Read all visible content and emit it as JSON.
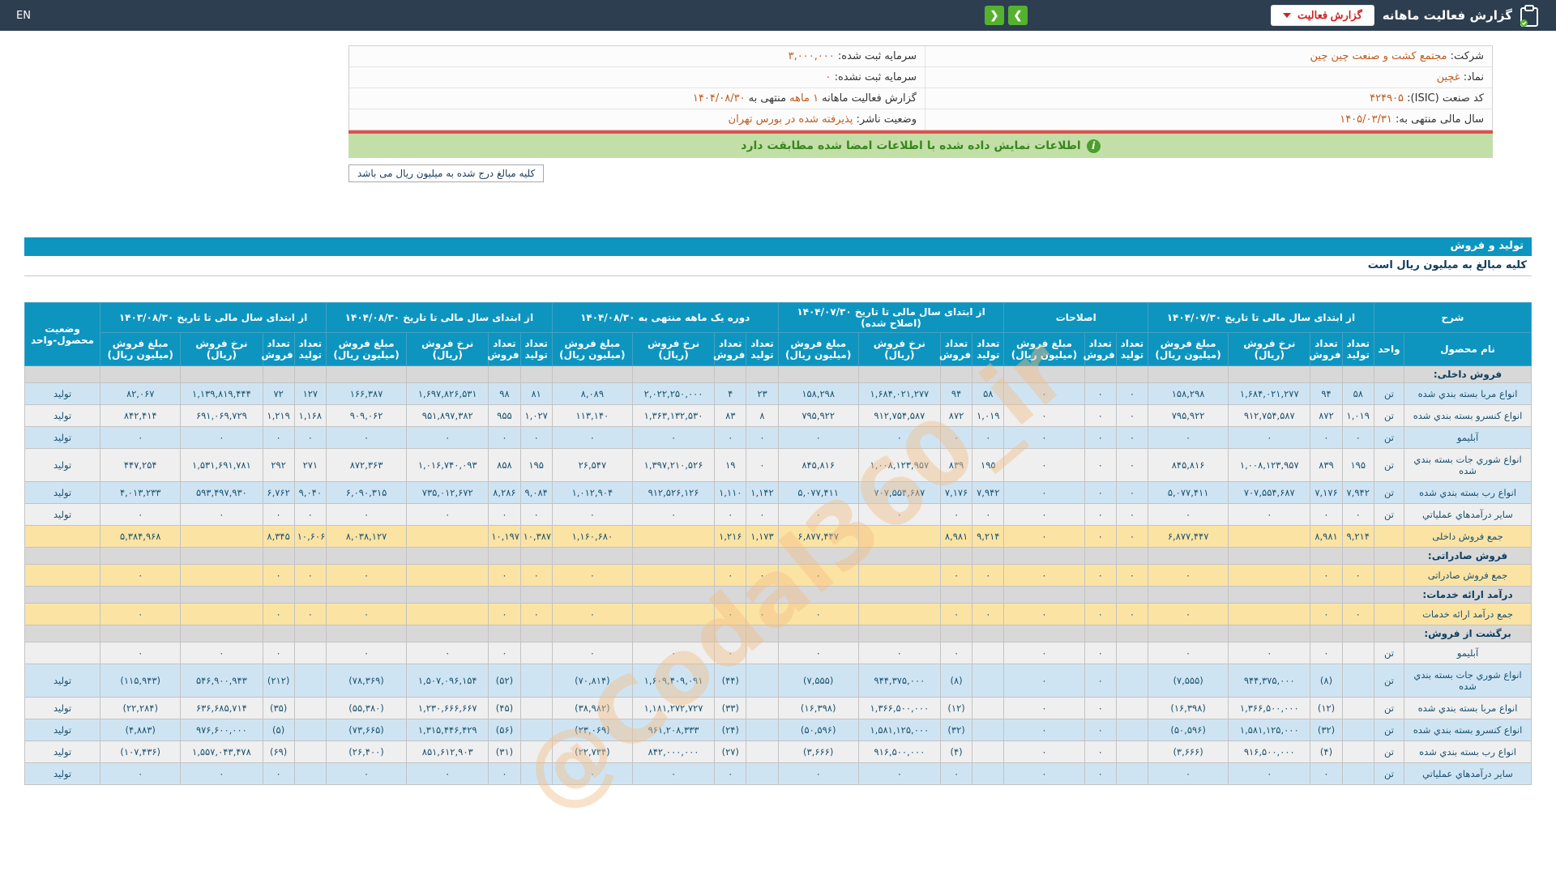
{
  "topbar": {
    "en": "EN",
    "title": "گزارش فعالیت ماهانه",
    "report_button": "گزارش فعالیت",
    "nav_next": "❯",
    "nav_prev": "❮"
  },
  "info": {
    "rows": [
      {
        "right": [
          [
            "l",
            "شرکت:"
          ],
          [
            "v",
            "مجتمع کشت و صنعت چین چین"
          ]
        ],
        "left": [
          [
            "l",
            "سرمایه ثبت شده:"
          ],
          [
            "v",
            "۳,۰۰۰,۰۰۰"
          ]
        ]
      },
      {
        "right": [
          [
            "l",
            "نماد:"
          ],
          [
            "v",
            "غچین"
          ]
        ],
        "left": [
          [
            "l",
            "سرمایه ثبت نشده:"
          ],
          [
            "v",
            "۰"
          ]
        ]
      },
      {
        "right": [
          [
            "l",
            "کد صنعت (ISIC):"
          ],
          [
            "v",
            "۴۲۴۹۰۵"
          ]
        ],
        "left": [
          [
            "l",
            "گزارش فعالیت ماهانه"
          ],
          [
            "v",
            "۱ ماهه"
          ],
          [
            "l",
            "منتهی به"
          ],
          [
            "v",
            "۱۴۰۴/۰۸/۳۰"
          ]
        ]
      },
      {
        "right": [
          [
            "l",
            "سال مالی منتهی به:"
          ],
          [
            "v",
            "۱۴۰۵/۰۳/۳۱"
          ]
        ],
        "left": [
          [
            "l",
            "وضعیت ناشر:"
          ],
          [
            "v",
            "پذیرفته شده در بورس تهران"
          ]
        ]
      }
    ]
  },
  "banner": {
    "text": "اطلاعات نمایش داده شده با اطلاعات امضا شده مطابقت دارد",
    "icon": "i"
  },
  "amounts_note": "کلیه مبالغ درج شده به میلیون ریال می باشد",
  "production_section": {
    "title": "تولید و فروش",
    "note": "کلیه مبالغ به میلیون ریال است"
  },
  "watermark": "@Codal360_ir",
  "table": {
    "groups": [
      {
        "label": "شرح",
        "cols": [
          {
            "label": "نام محصول",
            "key": "name"
          },
          {
            "label": "واحد",
            "key": "unit"
          }
        ]
      },
      {
        "label": "از ابتدای سال مالی تا تاریخ ۱۴۰۴/۰۷/۳۰",
        "cols": [
          {
            "label": "تعداد تولید",
            "key": "a_prod"
          },
          {
            "label": "تعداد فروش",
            "key": "a_sold"
          },
          {
            "label": "نرخ فروش (ریال)",
            "key": "a_rate"
          },
          {
            "label": "مبلغ فروش (میلیون ریال)",
            "key": "a_amt"
          }
        ]
      },
      {
        "label": "اصلاحات",
        "cols": [
          {
            "label": "تعداد تولید",
            "key": "adj_prod"
          },
          {
            "label": "تعداد فروش",
            "key": "adj_sold"
          },
          {
            "label": "مبلغ فروش (میلیون ریال)",
            "key": "adj_amt"
          }
        ]
      },
      {
        "label": "از ابتدای سال مالی تا تاریخ ۱۴۰۴/۰۷/۳۰ (اصلاح شده)",
        "cols": [
          {
            "label": "تعداد تولید",
            "key": "c_prod"
          },
          {
            "label": "تعداد فروش",
            "key": "c_sold"
          },
          {
            "label": "نرخ فروش (ریال)",
            "key": "c_rate"
          },
          {
            "label": "مبلغ فروش (میلیون ریال)",
            "key": "c_amt"
          }
        ]
      },
      {
        "label": "دوره یک ماهه منتهی به ۱۴۰۴/۰۸/۳۰",
        "cols": [
          {
            "label": "تعداد تولید",
            "key": "d_prod"
          },
          {
            "label": "تعداد فروش",
            "key": "d_sold"
          },
          {
            "label": "نرخ فروش (ریال)",
            "key": "d_rate"
          },
          {
            "label": "مبلغ فروش (میلیون ریال)",
            "key": "d_amt"
          }
        ]
      },
      {
        "label": "از ابتدای سال مالی تا تاریخ ۱۴۰۴/۰۸/۳۰",
        "cols": [
          {
            "label": "تعداد تولید",
            "key": "e_prod"
          },
          {
            "label": "تعداد فروش",
            "key": "e_sold"
          },
          {
            "label": "نرخ فروش (ریال)",
            "key": "e_rate"
          },
          {
            "label": "مبلغ فروش (میلیون ریال)",
            "key": "e_amt"
          }
        ]
      },
      {
        "label": "از ابتدای سال مالی تا تاریخ ۱۴۰۳/۰۸/۳۰",
        "cols": [
          {
            "label": "تعداد تولید",
            "key": "f_prod"
          },
          {
            "label": "تعداد فروش",
            "key": "f_sold"
          },
          {
            "label": "نرخ فروش (ریال)",
            "key": "f_rate"
          },
          {
            "label": "مبلغ فروش (میلیون ریال)",
            "key": "f_amt"
          }
        ]
      },
      {
        "label": "وضعیت محصول-واحد",
        "key": "status",
        "rowspan": true
      }
    ],
    "yellow_cols": [
      "a_rate",
      "c_prod",
      "c_sold",
      "c_rate",
      "c_amt",
      "d_rate",
      "e_rate",
      "e_amt",
      "f_rate"
    ],
    "rows": [
      {
        "type": "section",
        "name": "فروش داخلی:"
      },
      {
        "type": "data",
        "stripe": "blue",
        "name": "انواع مربا بسته بندي شده",
        "unit": "تن",
        "status": "تولید",
        "cells": {
          "a_prod": "۵۸",
          "a_sold": "۹۴",
          "a_rate": "۱,۶۸۴,۰۲۱,۲۷۷",
          "a_amt": "۱۵۸,۲۹۸",
          "adj_prod": "۰",
          "adj_sold": "۰",
          "adj_amt": "۰",
          "c_prod": "۵۸",
          "c_sold": "۹۴",
          "c_rate": "۱,۶۸۴,۰۲۱,۲۷۷",
          "c_amt": "۱۵۸,۲۹۸",
          "d_prod": "۲۳",
          "d_sold": "۴",
          "d_rate": "۲,۰۲۲,۲۵۰,۰۰۰",
          "d_amt": "۸,۰۸۹",
          "e_prod": "۸۱",
          "e_sold": "۹۸",
          "e_rate": "۱,۶۹۷,۸۲۶,۵۳۱",
          "e_amt": "۱۶۶,۳۸۷",
          "f_prod": "۱۲۷",
          "f_sold": "۷۲",
          "f_rate": "۱,۱۳۹,۸۱۹,۴۴۴",
          "f_amt": "۸۲,۰۶۷"
        }
      },
      {
        "type": "data",
        "stripe": "gray",
        "name": "انواع کنسرو بسته بندي شده",
        "unit": "تن",
        "status": "تولید",
        "cells": {
          "a_prod": "۱,۰۱۹",
          "a_sold": "۸۷۲",
          "a_rate": "۹۱۲,۷۵۴,۵۸۷",
          "a_amt": "۷۹۵,۹۲۲",
          "adj_prod": "۰",
          "adj_sold": "۰",
          "adj_amt": "۰",
          "c_prod": "۱,۰۱۹",
          "c_sold": "۸۷۲",
          "c_rate": "۹۱۲,۷۵۴,۵۸۷",
          "c_amt": "۷۹۵,۹۲۲",
          "d_prod": "۸",
          "d_sold": "۸۳",
          "d_rate": "۱,۳۶۳,۱۳۲,۵۳۰",
          "d_amt": "۱۱۳,۱۴۰",
          "e_prod": "۱,۰۲۷",
          "e_sold": "۹۵۵",
          "e_rate": "۹۵۱,۸۹۷,۳۸۲",
          "e_amt": "۹۰۹,۰۶۲",
          "f_prod": "۱,۱۶۸",
          "f_sold": "۱,۲۱۹",
          "f_rate": "۶۹۱,۰۶۹,۷۲۹",
          "f_amt": "۸۴۲,۴۱۴"
        }
      },
      {
        "type": "data",
        "stripe": "blue",
        "name": "آبليمو",
        "unit": "تن",
        "status": "تولید",
        "cells": {
          "a_prod": "۰",
          "a_sold": "۰",
          "a_rate": "۰",
          "a_amt": "۰",
          "adj_prod": "۰",
          "adj_sold": "۰",
          "adj_amt": "۰",
          "c_prod": "۰",
          "c_sold": "۰",
          "c_rate": "۰",
          "c_amt": "۰",
          "d_prod": "۰",
          "d_sold": "۰",
          "d_rate": "۰",
          "d_amt": "۰",
          "e_prod": "۰",
          "e_sold": "۰",
          "e_rate": "۰",
          "e_amt": "۰",
          "f_prod": "۰",
          "f_sold": "۰",
          "f_rate": "۰",
          "f_amt": "۰"
        }
      },
      {
        "type": "data",
        "stripe": "gray",
        "name": "انواع شوري جات بسته بندي شده",
        "unit": "تن",
        "status": "تولید",
        "cells": {
          "a_prod": "۱۹۵",
          "a_sold": "۸۳۹",
          "a_rate": "۱,۰۰۸,۱۲۳,۹۵۷",
          "a_amt": "۸۴۵,۸۱۶",
          "adj_prod": "۰",
          "adj_sold": "۰",
          "adj_amt": "۰",
          "c_prod": "۱۹۵",
          "c_sold": "۸۳۹",
          "c_rate": "۱,۰۰۸,۱۲۳,۹۵۷",
          "c_amt": "۸۴۵,۸۱۶",
          "d_prod": "۰",
          "d_sold": "۱۹",
          "d_rate": "۱,۳۹۷,۲۱۰,۵۲۶",
          "d_amt": "۲۶,۵۴۷",
          "e_prod": "۱۹۵",
          "e_sold": "۸۵۸",
          "e_rate": "۱,۰۱۶,۷۴۰,۰۹۳",
          "e_amt": "۸۷۲,۳۶۳",
          "f_prod": "۲۷۱",
          "f_sold": "۲۹۲",
          "f_rate": "۱,۵۳۱,۶۹۱,۷۸۱",
          "f_amt": "۴۴۷,۲۵۴"
        }
      },
      {
        "type": "data",
        "stripe": "blue",
        "name": "انواع رب بسته بندي شده",
        "unit": "تن",
        "status": "تولید",
        "cells": {
          "a_prod": "۷,۹۴۲",
          "a_sold": "۷,۱۷۶",
          "a_rate": "۷۰۷,۵۵۴,۶۸۷",
          "a_amt": "۵,۰۷۷,۴۱۱",
          "adj_prod": "۰",
          "adj_sold": "۰",
          "adj_amt": "۰",
          "c_prod": "۷,۹۴۲",
          "c_sold": "۷,۱۷۶",
          "c_rate": "۷۰۷,۵۵۴,۶۸۷",
          "c_amt": "۵,۰۷۷,۴۱۱",
          "d_prod": "۱,۱۴۲",
          "d_sold": "۱,۱۱۰",
          "d_rate": "۹۱۲,۵۲۶,۱۲۶",
          "d_amt": "۱,۰۱۲,۹۰۴",
          "e_prod": "۹,۰۸۴",
          "e_sold": "۸,۲۸۶",
          "e_rate": "۷۳۵,۰۱۲,۶۷۲",
          "e_amt": "۶,۰۹۰,۳۱۵",
          "f_prod": "۹,۰۴۰",
          "f_sold": "۶,۷۶۲",
          "f_rate": "۵۹۳,۴۹۷,۹۳۰",
          "f_amt": "۴,۰۱۳,۲۳۳"
        }
      },
      {
        "type": "data",
        "stripe": "gray",
        "name": "ساير درآمدهاي عملياتي",
        "unit": "تن",
        "status": "تولید",
        "cells": {
          "a_prod": "۰",
          "a_sold": "۰",
          "a_rate": "۰",
          "a_amt": "۰",
          "adj_prod": "۰",
          "adj_sold": "۰",
          "adj_amt": "۰",
          "c_prod": "۰",
          "c_sold": "۰",
          "c_rate": "۰",
          "c_amt": "۰",
          "d_prod": "۰",
          "d_sold": "۰",
          "d_rate": "۰",
          "d_amt": "۰",
          "e_prod": "۰",
          "e_sold": "۰",
          "e_rate": "۰",
          "e_amt": "۰",
          "f_prod": "۰",
          "f_sold": "۰",
          "f_rate": "۰",
          "f_amt": "۰"
        }
      },
      {
        "type": "total",
        "name": "جمع فروش داخلی",
        "unit": "",
        "status": "",
        "cells": {
          "a_prod": "۹,۲۱۴",
          "a_sold": "۸,۹۸۱",
          "a_amt": "۶,۸۷۷,۴۴۷",
          "adj_prod": "۰",
          "adj_sold": "۰",
          "adj_amt": "۰",
          "c_prod": "۹,۲۱۴",
          "c_sold": "۸,۹۸۱",
          "c_amt": "۶,۸۷۷,۴۴۷",
          "d_prod": "۱,۱۷۳",
          "d_sold": "۱,۲۱۶",
          "d_amt": "۱,۱۶۰,۶۸۰",
          "e_prod": "۱۰,۳۸۷",
          "e_sold": "۱۰,۱۹۷",
          "e_amt": "۸,۰۳۸,۱۲۷",
          "f_prod": "۱۰,۶۰۶",
          "f_sold": "۸,۳۴۵",
          "f_amt": "۵,۳۸۴,۹۶۸"
        }
      },
      {
        "type": "section",
        "name": "فروش صادراتی:"
      },
      {
        "type": "total",
        "name": "جمع فروش صادراتی",
        "unit": "",
        "status": "",
        "cells": {
          "a_prod": "۰",
          "a_sold": "۰",
          "a_amt": "۰",
          "adj_prod": "۰",
          "adj_sold": "۰",
          "adj_amt": "۰",
          "c_prod": "۰",
          "c_sold": "۰",
          "c_amt": "۰",
          "d_prod": "۰",
          "d_sold": "۰",
          "d_amt": "۰",
          "e_prod": "۰",
          "e_sold": "۰",
          "e_amt": "۰",
          "f_prod": "۰",
          "f_sold": "۰",
          "f_amt": "۰"
        }
      },
      {
        "type": "section",
        "name": "درآمد ارائه خدمات:"
      },
      {
        "type": "total",
        "name": "جمع درآمد ارائه خدمات",
        "unit": "",
        "status": "",
        "cells": {
          "a_prod": "۰",
          "a_sold": "۰",
          "a_amt": "۰",
          "adj_prod": "۰",
          "adj_sold": "۰",
          "adj_amt": "۰",
          "c_prod": "۰",
          "c_sold": "۰",
          "c_amt": "۰",
          "d_prod": "۰",
          "d_sold": "۰",
          "d_amt": "۰",
          "e_prod": "۰",
          "e_sold": "۰",
          "e_amt": "۰",
          "f_prod": "۰",
          "f_sold": "۰",
          "f_amt": "۰"
        }
      },
      {
        "type": "section",
        "name": "برگشت از فروش:"
      },
      {
        "type": "data",
        "stripe": "gray",
        "name": "آبليمو",
        "unit": "تن",
        "status": "",
        "zeros_red": true,
        "cells": {
          "a_sold": "۰",
          "a_rate": "۰",
          "a_amt": "۰",
          "adj_sold": "۰",
          "adj_amt": "۰",
          "c_sold": "۰",
          "c_rate": "۰",
          "c_amt": "۰",
          "d_sold": "۰",
          "d_rate": "۰",
          "d_amt": "۰",
          "e_sold": "۰",
          "e_rate": "۰",
          "e_amt": "۰",
          "f_sold": "۰",
          "f_rate": "۰",
          "f_amt": "۰"
        }
      },
      {
        "type": "data",
        "stripe": "blue",
        "name": "انواع شوري جات بسته بندي شده",
        "unit": "تن",
        "status": "تولید",
        "cells": {
          "a_sold": "(۸)",
          "a_rate": "۹۴۴,۳۷۵,۰۰۰",
          "a_amt": "(۷,۵۵۵)",
          "adj_sold": "۰",
          "adj_amt": "۰",
          "c_sold": "(۸)",
          "c_rate": "۹۴۴,۳۷۵,۰۰۰",
          "c_amt": "(۷,۵۵۵)",
          "d_sold": "(۴۴)",
          "d_rate": "۱,۶۰۹,۴۰۹,۰۹۱",
          "d_amt": "(۷۰,۸۱۴)",
          "e_sold": "(۵۲)",
          "e_rate": "۱,۵۰۷,۰۹۶,۱۵۴",
          "e_amt": "(۷۸,۳۶۹)",
          "f_sold": "(۲۱۲)",
          "f_rate": "۵۴۶,۹۰۰,۹۴۳",
          "f_amt": "(۱۱۵,۹۴۳)"
        }
      },
      {
        "type": "data",
        "stripe": "gray",
        "name": "انواع مربا بسته بندي شده",
        "unit": "تن",
        "status": "تولید",
        "cells": {
          "a_sold": "(۱۲)",
          "a_rate": "۱,۳۶۶,۵۰۰,۰۰۰",
          "a_amt": "(۱۶,۳۹۸)",
          "adj_sold": "۰",
          "adj_amt": "۰",
          "c_sold": "(۱۲)",
          "c_rate": "۱,۳۶۶,۵۰۰,۰۰۰",
          "c_amt": "(۱۶,۳۹۸)",
          "d_sold": "(۳۳)",
          "d_rate": "۱,۱۸۱,۲۷۲,۷۲۷",
          "d_amt": "(۳۸,۹۸۲)",
          "e_sold": "(۴۵)",
          "e_rate": "۱,۲۳۰,۶۶۶,۶۶۷",
          "e_amt": "(۵۵,۳۸۰)",
          "f_sold": "(۳۵)",
          "f_rate": "۶۳۶,۶۸۵,۷۱۴",
          "f_amt": "(۲۲,۲۸۴)"
        }
      },
      {
        "type": "data",
        "stripe": "blue",
        "name": "انواع کنسرو بسته بندي شده",
        "unit": "تن",
        "status": "تولید",
        "cells": {
          "a_sold": "(۳۲)",
          "a_rate": "۱,۵۸۱,۱۲۵,۰۰۰",
          "a_amt": "(۵۰,۵۹۶)",
          "adj_sold": "۰",
          "adj_amt": "۰",
          "c_sold": "(۳۲)",
          "c_rate": "۱,۵۸۱,۱۲۵,۰۰۰",
          "c_amt": "(۵۰,۵۹۶)",
          "d_sold": "(۲۴)",
          "d_rate": "۹۶۱,۲۰۸,۳۳۳",
          "d_amt": "(۲۳,۰۶۹)",
          "e_sold": "(۵۶)",
          "e_rate": "۱,۳۱۵,۴۴۶,۴۲۹",
          "e_amt": "(۷۳,۶۶۵)",
          "f_sold": "(۵)",
          "f_rate": "۹۷۶,۶۰۰,۰۰۰",
          "f_amt": "(۴,۸۸۳)"
        }
      },
      {
        "type": "data",
        "stripe": "gray",
        "name": "انواع رب بسته بندي شده",
        "unit": "تن",
        "status": "تولید",
        "cells": {
          "a_sold": "(۴)",
          "a_rate": "۹۱۶,۵۰۰,۰۰۰",
          "a_amt": "(۳,۶۶۶)",
          "adj_sold": "۰",
          "adj_amt": "۰",
          "c_sold": "(۴)",
          "c_rate": "۹۱۶,۵۰۰,۰۰۰",
          "c_amt": "(۳,۶۶۶)",
          "d_sold": "(۲۷)",
          "d_rate": "۸۴۲,۰۰۰,۰۰۰",
          "d_amt": "(۲۲,۷۳۴)",
          "e_sold": "(۳۱)",
          "e_rate": "۸۵۱,۶۱۲,۹۰۳",
          "e_amt": "(۲۶,۴۰۰)",
          "f_sold": "(۶۹)",
          "f_rate": "۱,۵۵۷,۰۴۳,۴۷۸",
          "f_amt": "(۱۰۷,۴۳۶)"
        }
      },
      {
        "type": "data",
        "stripe": "blue",
        "name": "ساير درآمدهاي عملياتي",
        "unit": "تن",
        "status": "تولید",
        "zeros_red": true,
        "cells": {
          "a_sold": "۰",
          "a_rate": "۰",
          "a_amt": "۰",
          "adj_sold": "۰",
          "adj_amt": "۰",
          "c_sold": "۰",
          "c_rate": "۰",
          "c_amt": "۰",
          "d_sold": "۰",
          "d_rate": "۰",
          "d_amt": "۰",
          "e_sold": "۰",
          "e_rate": "۰",
          "e_amt": "۰",
          "f_sold": "۰",
          "f_rate": "۰",
          "f_amt": "۰"
        }
      }
    ]
  }
}
